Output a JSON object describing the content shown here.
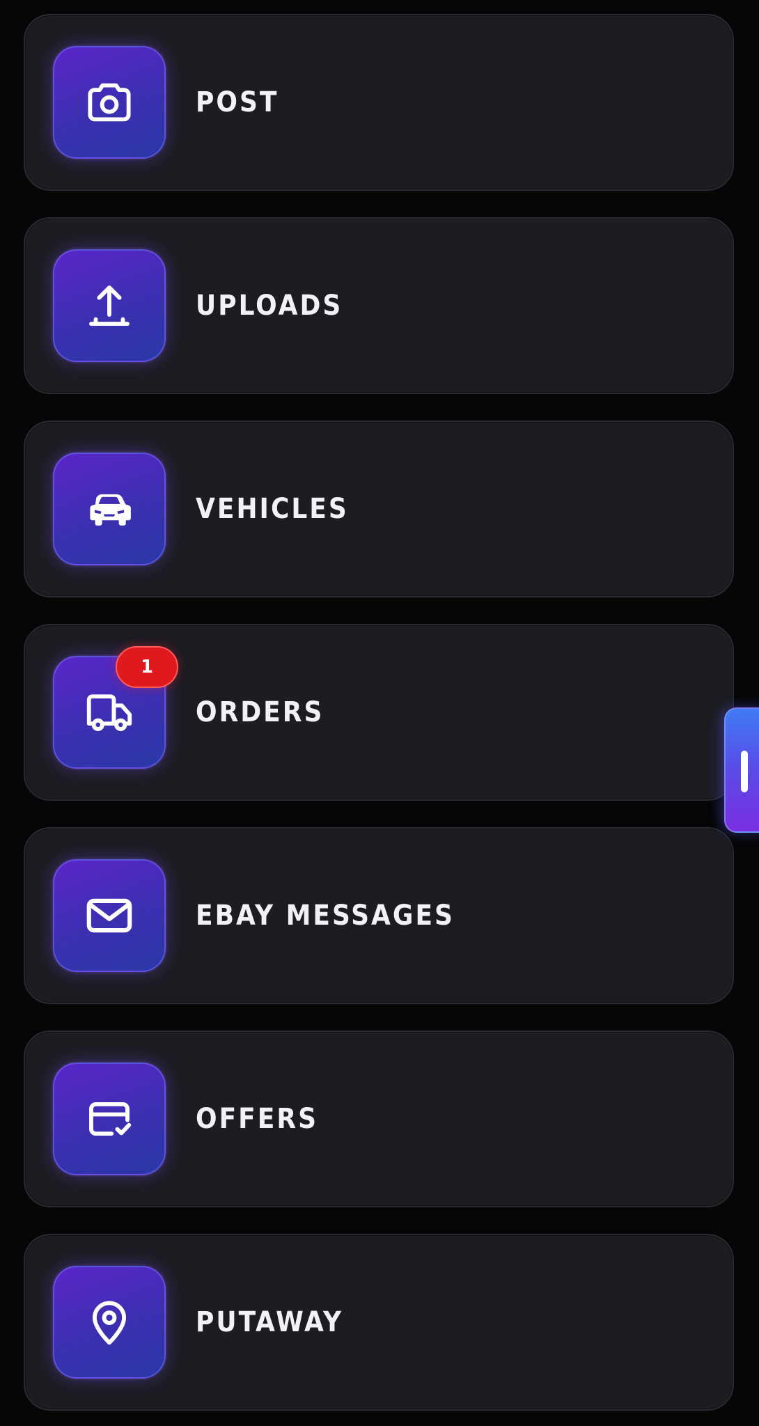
{
  "menu": {
    "items": [
      {
        "label": "POST",
        "icon": "camera-icon"
      },
      {
        "label": "UPLOADS",
        "icon": "upload-icon"
      },
      {
        "label": "VEHICLES",
        "icon": "car-icon"
      },
      {
        "label": "ORDERS",
        "icon": "truck-icon",
        "badge": "1"
      },
      {
        "label": "EBAY MESSAGES",
        "icon": "mail-icon"
      },
      {
        "label": "OFFERS",
        "icon": "card-check-icon"
      },
      {
        "label": "PUTAWAY",
        "icon": "map-pin-icon"
      }
    ]
  },
  "colors": {
    "background": "#060607",
    "card": "#1c1c21",
    "icon_tile_gradient": [
      "#5a26c9",
      "#2a38a8"
    ],
    "badge": "#e0191f",
    "handle_gradient": [
      "#3f7bf5",
      "#7a2fe0"
    ],
    "label_text": "#f2f2f4"
  }
}
